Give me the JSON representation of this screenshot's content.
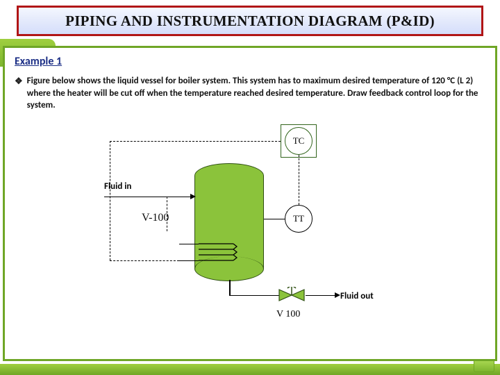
{
  "title": "PIPING AND INSTRUMENTATION DIAGRAM (P&ID)",
  "section": "Example 1",
  "bullet": "Figure below shows the liquid vessel for boiler system. This system has to  maximum desired temperature of 120 °C (L 2) where the heater will be cut off when the temperature reached desired temperature. Draw feedback control loop for the system.",
  "diagram": {
    "fluid_in": "Fluid in",
    "vessel_tag": "V-100",
    "tt": "TT",
    "tc": "TC",
    "valve_tag": "V 100",
    "fluid_out": "Fluid out"
  }
}
